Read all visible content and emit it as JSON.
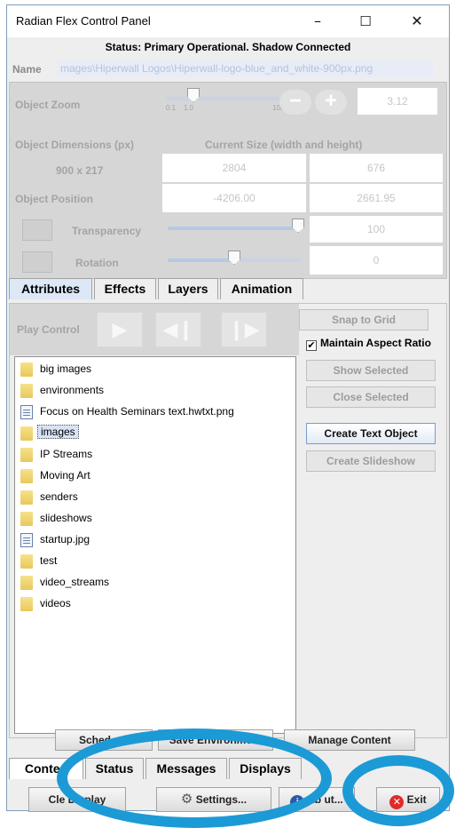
{
  "window": {
    "title": "Radian Flex Control Panel",
    "minimize": "–",
    "maximize": "☐",
    "close": "✕"
  },
  "status_line": "Status: Primary Operational. Shadow Connected",
  "name_field": {
    "label": "Name",
    "value": "mages\\Hiperwall Logos\\Hiperwall-logo-blue_and_white-900px.png"
  },
  "attributes": {
    "object_zoom_label": "Object Zoom",
    "zoom_ticks": [
      "0.1",
      "1.0",
      "100"
    ],
    "zoom_minus": "−",
    "zoom_plus": "+",
    "zoom_value": "3.12",
    "dimensions_label": "Object Dimensions (px)",
    "current_size_label": "Current Size (width and height)",
    "dimensions_value": "900 x 217",
    "current_width": "2804",
    "current_height": "676",
    "position_label": "Object Position",
    "position_x": "-4206.00",
    "position_y": "2661.95",
    "transparency_label": "Transparency",
    "transparency_value": "100",
    "transparency_level": 1.0,
    "rotation_label": "Rotation",
    "rotation_value": "0",
    "rotation_level": 0.5
  },
  "top_tabs": [
    "Attributes",
    "Effects",
    "Layers",
    "Animation"
  ],
  "play_control": {
    "label": "Play Control"
  },
  "right_controls": {
    "snap_to_grid": "Snap to Grid",
    "maintain_aspect_ratio": "Maintain Aspect Ratio",
    "maintain_checked": true,
    "show_selected": "Show Selected",
    "close_selected": "Close Selected",
    "create_text_object": "Create Text Object",
    "create_slideshow": "Create Slideshow"
  },
  "files": [
    {
      "name": "big images",
      "type": "folder"
    },
    {
      "name": "environments",
      "type": "folder"
    },
    {
      "name": "Focus on Health Seminars text.hwtxt.png",
      "type": "file"
    },
    {
      "name": "images",
      "type": "folder",
      "selected": true
    },
    {
      "name": "IP Streams",
      "type": "folder"
    },
    {
      "name": "Moving Art",
      "type": "folder"
    },
    {
      "name": "senders",
      "type": "folder"
    },
    {
      "name": "slideshows",
      "type": "folder"
    },
    {
      "name": "startup.jpg",
      "type": "file"
    },
    {
      "name": "test",
      "type": "folder"
    },
    {
      "name": "video_streams",
      "type": "folder"
    },
    {
      "name": "videos",
      "type": "folder"
    }
  ],
  "action_buttons": {
    "schedule": "Sched      e...",
    "save_environment": "Save Environment",
    "manage_content": "Manage Content"
  },
  "bottom_tabs": [
    "Conte   t",
    "Status",
    "Messages",
    "Displays"
  ],
  "bottom_buttons": {
    "clear_display": "Cle    Display",
    "settings": "Settings...",
    "about": "Ab    ut...",
    "exit": "Exit"
  },
  "colors": {
    "highlight_ring": "#1c9ad6",
    "exit_icon": "#e02b2b"
  }
}
